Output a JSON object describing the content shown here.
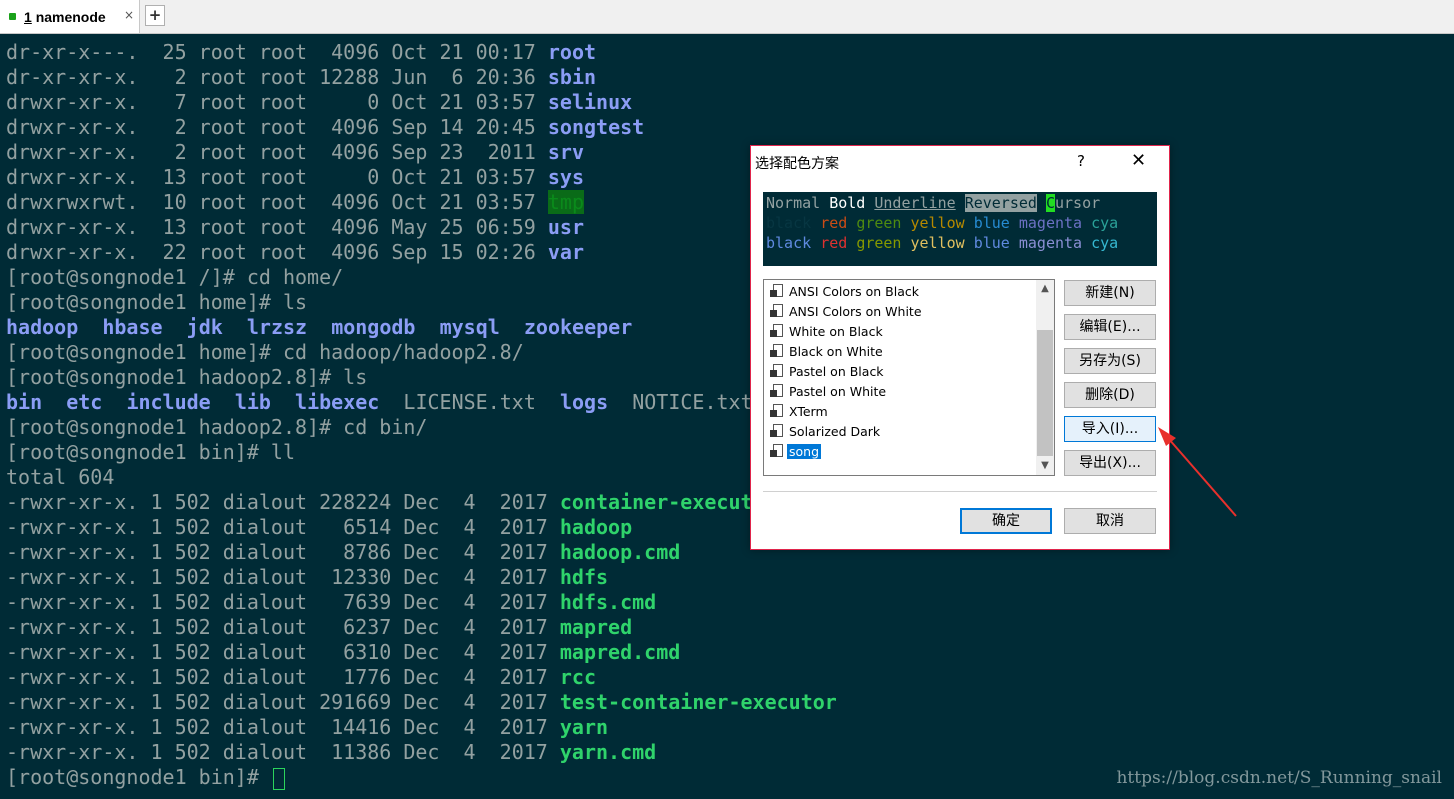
{
  "tab": {
    "number": "1",
    "label": "namenode",
    "close": "×",
    "add": "+"
  },
  "terminal_lines": [
    [
      {
        "t": "dr-xr-x---.  25 root root  4096 Oct 21 00:17 "
      },
      {
        "t": "root",
        "c": "dir"
      }
    ],
    [
      {
        "t": "dr-xr-xr-x.   2 root root 12288 Jun  6 20:36 "
      },
      {
        "t": "sbin",
        "c": "dir"
      }
    ],
    [
      {
        "t": "drwxr-xr-x.   7 root root     0 Oct 21 03:57 "
      },
      {
        "t": "selinux",
        "c": "dir"
      }
    ],
    [
      {
        "t": "drwxr-xr-x.   2 root root  4096 Sep 14 20:45 "
      },
      {
        "t": "songtest",
        "c": "dir"
      }
    ],
    [
      {
        "t": "drwxr-xr-x.   2 root root  4096 Sep 23  2011 "
      },
      {
        "t": "srv",
        "c": "dir"
      }
    ],
    [
      {
        "t": "drwxr-xr-x.  13 root root     0 Oct 21 03:57 "
      },
      {
        "t": "sys",
        "c": "dir"
      }
    ],
    [
      {
        "t": "drwxrwxrwt.  10 root root  4096 Oct 21 03:57 "
      },
      {
        "t": "tmp",
        "c": "hl"
      }
    ],
    [
      {
        "t": "drwxr-xr-x.  13 root root  4096 May 25 06:59 "
      },
      {
        "t": "usr",
        "c": "dir"
      }
    ],
    [
      {
        "t": "drwxr-xr-x.  22 root root  4096 Sep 15 02:26 "
      },
      {
        "t": "var",
        "c": "dir"
      }
    ],
    [
      {
        "t": "[root@songnode1 /]# cd home/"
      }
    ],
    [
      {
        "t": "[root@songnode1 home]# ls"
      }
    ],
    [
      {
        "t": "hadoop",
        "c": "dir"
      },
      {
        "t": "  "
      },
      {
        "t": "hbase",
        "c": "dir"
      },
      {
        "t": "  "
      },
      {
        "t": "jdk",
        "c": "dir"
      },
      {
        "t": "  "
      },
      {
        "t": "lrzsz",
        "c": "dir"
      },
      {
        "t": "  "
      },
      {
        "t": "mongodb",
        "c": "dir"
      },
      {
        "t": "  "
      },
      {
        "t": "mysql",
        "c": "dir"
      },
      {
        "t": "  "
      },
      {
        "t": "zookeeper",
        "c": "dir"
      }
    ],
    [
      {
        "t": "[root@songnode1 home]# cd hadoop/hadoop2.8/"
      }
    ],
    [
      {
        "t": "[root@songnode1 hadoop2.8]# ls"
      }
    ],
    [
      {
        "t": "bin",
        "c": "dir"
      },
      {
        "t": "  "
      },
      {
        "t": "etc",
        "c": "dir"
      },
      {
        "t": "  "
      },
      {
        "t": "include",
        "c": "dir"
      },
      {
        "t": "  "
      },
      {
        "t": "lib",
        "c": "dir"
      },
      {
        "t": "  "
      },
      {
        "t": "libexec",
        "c": "dir"
      },
      {
        "t": "  LICENSE.txt  "
      },
      {
        "t": "logs",
        "c": "dir"
      },
      {
        "t": "  NOTICE.txt"
      }
    ],
    [
      {
        "t": "[root@songnode1 hadoop2.8]# cd bin/"
      }
    ],
    [
      {
        "t": "[root@songnode1 bin]# ll"
      }
    ],
    [
      {
        "t": "total 604"
      }
    ],
    [
      {
        "t": "-rwxr-xr-x. 1 502 dialout 228224 Dec  4  2017 "
      },
      {
        "t": "container-executor",
        "c": "exe"
      }
    ],
    [
      {
        "t": "-rwxr-xr-x. 1 502 dialout   6514 Dec  4  2017 "
      },
      {
        "t": "hadoop",
        "c": "exe"
      }
    ],
    [
      {
        "t": "-rwxr-xr-x. 1 502 dialout   8786 Dec  4  2017 "
      },
      {
        "t": "hadoop.cmd",
        "c": "exe"
      }
    ],
    [
      {
        "t": "-rwxr-xr-x. 1 502 dialout  12330 Dec  4  2017 "
      },
      {
        "t": "hdfs",
        "c": "exe"
      }
    ],
    [
      {
        "t": "-rwxr-xr-x. 1 502 dialout   7639 Dec  4  2017 "
      },
      {
        "t": "hdfs.cmd",
        "c": "exe"
      }
    ],
    [
      {
        "t": "-rwxr-xr-x. 1 502 dialout   6237 Dec  4  2017 "
      },
      {
        "t": "mapred",
        "c": "exe"
      }
    ],
    [
      {
        "t": "-rwxr-xr-x. 1 502 dialout   6310 Dec  4  2017 "
      },
      {
        "t": "mapred.cmd",
        "c": "exe"
      }
    ],
    [
      {
        "t": "-rwxr-xr-x. 1 502 dialout   1776 Dec  4  2017 "
      },
      {
        "t": "rcc",
        "c": "exe"
      }
    ],
    [
      {
        "t": "-rwxr-xr-x. 1 502 dialout 291669 Dec  4  2017 "
      },
      {
        "t": "test-container-executor",
        "c": "exe"
      }
    ],
    [
      {
        "t": "-rwxr-xr-x. 1 502 dialout  14416 Dec  4  2017 "
      },
      {
        "t": "yarn",
        "c": "exe"
      }
    ],
    [
      {
        "t": "-rwxr-xr-x. 1 502 dialout  11386 Dec  4  2017 "
      },
      {
        "t": "yarn.cmd",
        "c": "exe"
      }
    ],
    [
      {
        "t": "[root@songnode1 bin]# "
      }
    ]
  ],
  "watermark": "https://blog.csdn.net/S_Running_snail",
  "dialog": {
    "title": "选择配色方案",
    "help": "?",
    "close": "✕",
    "preview": {
      "line1": [
        "Normal",
        "Bold",
        "Underline",
        "Reversed",
        "C",
        "ursor"
      ],
      "line2": [
        "black",
        "red",
        "green",
        "yellow",
        "blue",
        "magenta",
        "cya"
      ],
      "line3": [
        "black",
        "red",
        "green",
        "yellow",
        "blue",
        "magenta",
        "cya"
      ]
    },
    "schemes": [
      "ANSI Colors on Black",
      "ANSI Colors on White",
      "White on Black",
      "Black on White",
      "Pastel on Black",
      "Pastel on White",
      "XTerm",
      "Solarized Dark",
      "song"
    ],
    "selected_scheme": "song",
    "buttons": {
      "new": "新建(N)",
      "edit": "编辑(E)...",
      "save_as": "另存为(S)",
      "delete": "删除(D)",
      "import": "导入(I)...",
      "export": "导出(X)...",
      "ok": "确定",
      "cancel": "取消"
    }
  },
  "colors": {
    "terminal_bg": "#002b36",
    "terminal_fg": "#93a1a1",
    "dir": "#8b9df5",
    "exe": "#2fd36b",
    "annotation_arrow": "#e8302c"
  }
}
